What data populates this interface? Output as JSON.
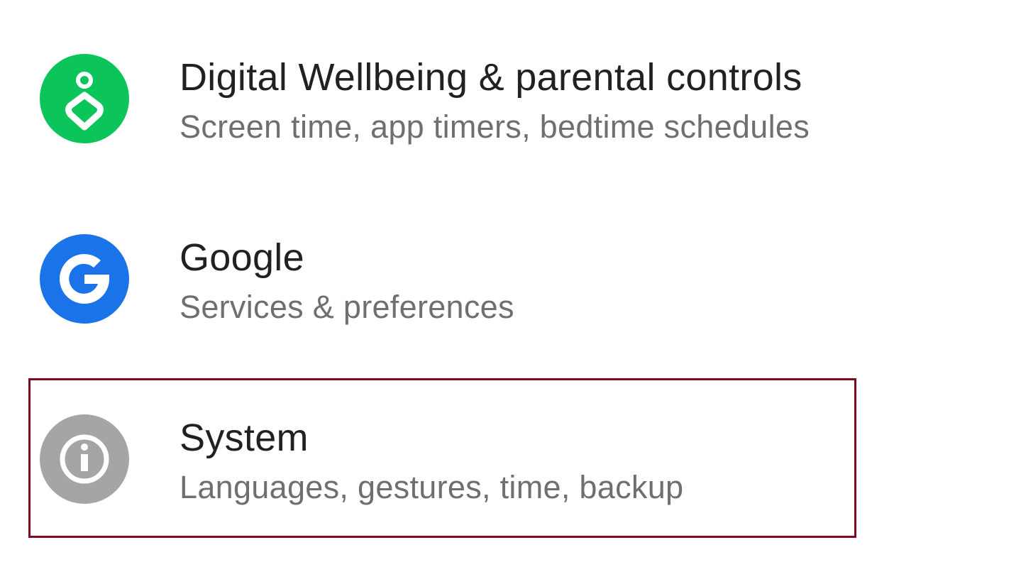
{
  "settings_items": [
    {
      "title": "Digital Wellbeing & parental controls",
      "subtitle": "Screen time, app timers, bedtime schedules",
      "icon": "digital-wellbeing-icon",
      "icon_color": "#0BC55A"
    },
    {
      "title": "Google",
      "subtitle": "Services & preferences",
      "icon": "google-icon",
      "icon_color": "#1A73E8"
    },
    {
      "title": "System",
      "subtitle": "Languages, gestures, time, backup",
      "icon": "info-icon",
      "icon_color": "#A5A5A5"
    }
  ],
  "highlight": {
    "target": "System",
    "color": "#7D0A1E"
  }
}
